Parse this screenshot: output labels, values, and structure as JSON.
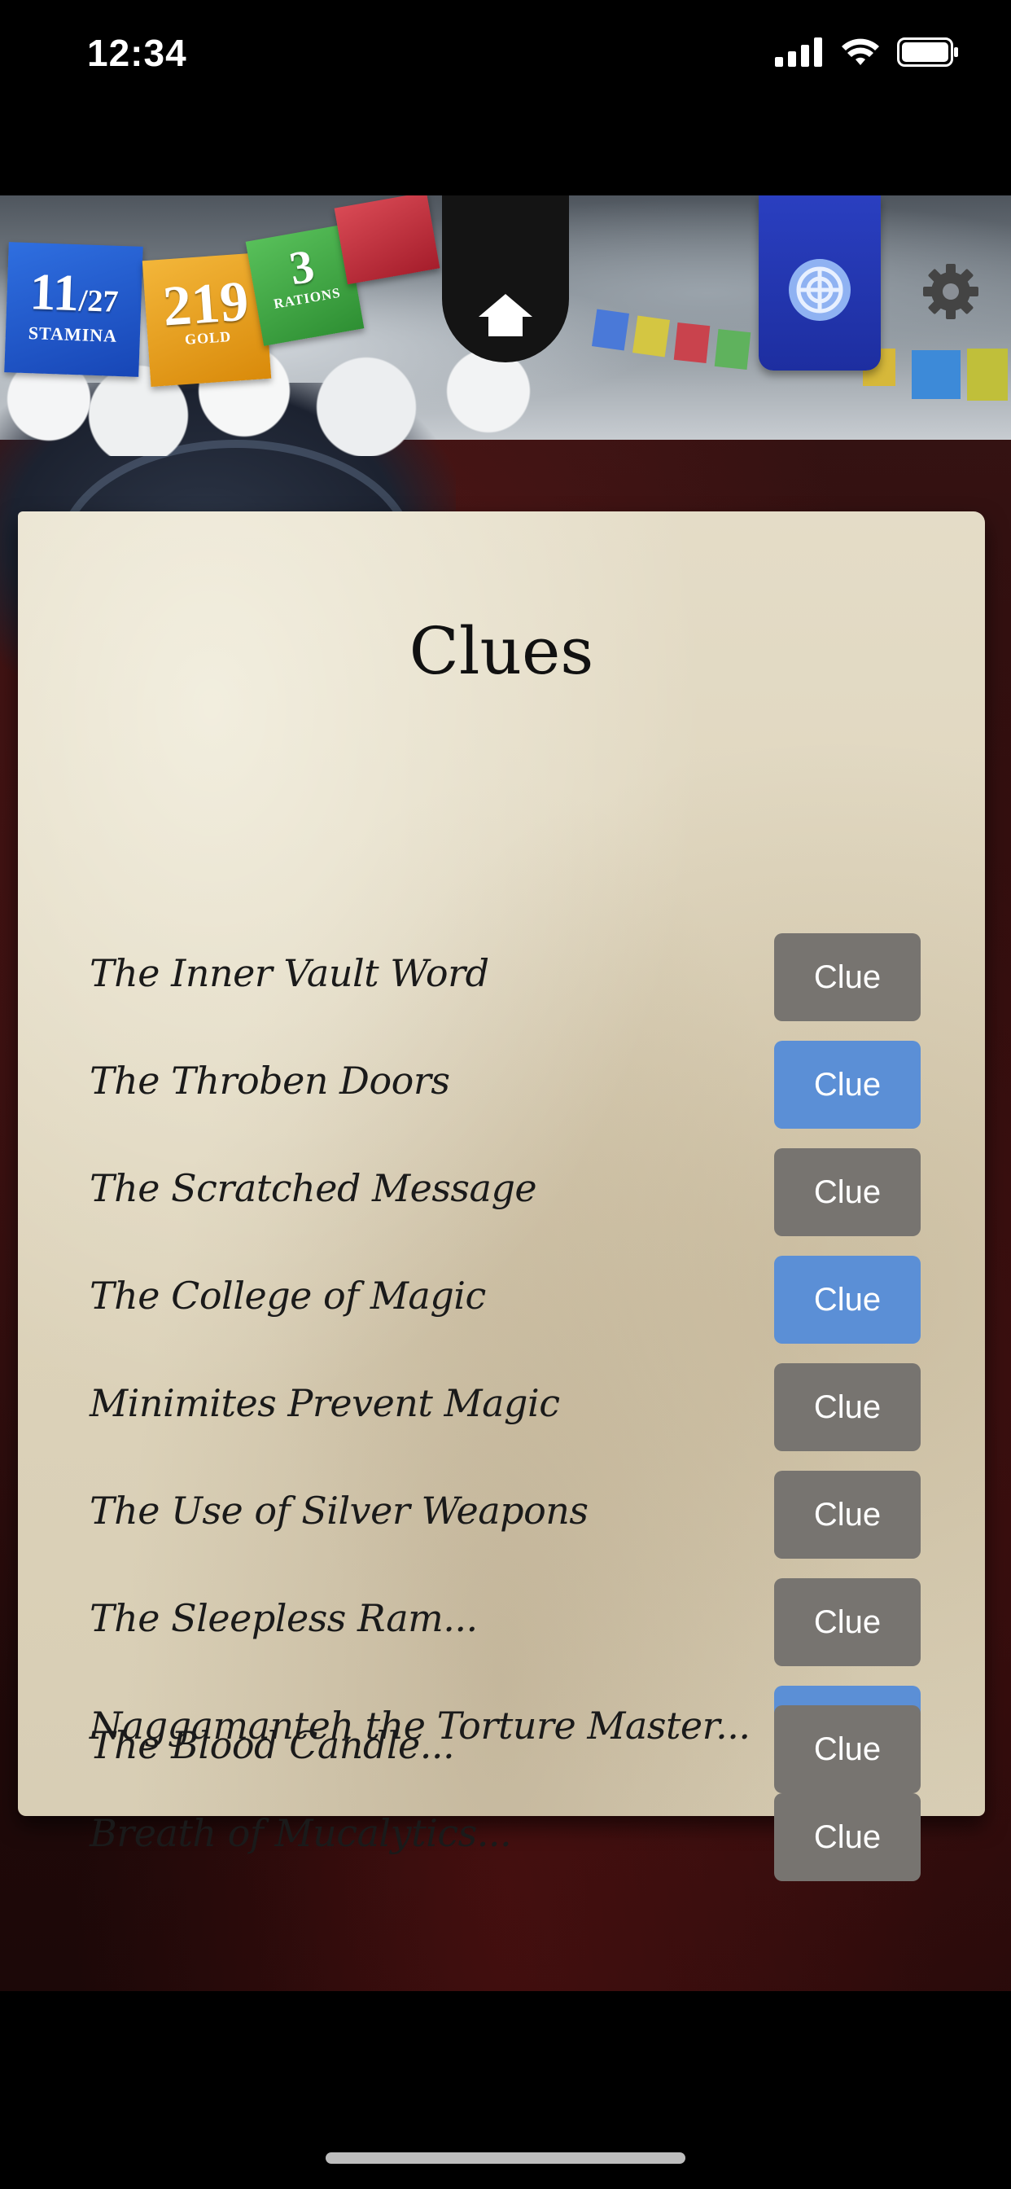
{
  "status_bar": {
    "time": "12:34"
  },
  "hud": {
    "stamina": {
      "current": "11",
      "max": "/27",
      "label": "STAMINA",
      "color": "#2f6fe0"
    },
    "gold": {
      "value": "219",
      "label": "GOLD",
      "color": "#f3b63a"
    },
    "rations": {
      "value": "3",
      "label": "RATIONS",
      "color": "#58c05a"
    },
    "home_icon": "home-icon",
    "settings_icon": "gear-icon"
  },
  "clues_page": {
    "title": "Clues",
    "items": [
      {
        "label": "The Inner Vault Word",
        "button": "Clue",
        "style": "grey"
      },
      {
        "label": "The Throben Doors",
        "button": "Clue",
        "style": "blue"
      },
      {
        "label": "The Scratched Message",
        "button": "Clue",
        "style": "grey"
      },
      {
        "label": "The College of Magic",
        "button": "Clue",
        "style": "blue"
      },
      {
        "label": "Minimites Prevent Magic",
        "button": "Clue",
        "style": "grey"
      },
      {
        "label": "The Use of Silver Weapons",
        "button": "Clue",
        "style": "grey"
      },
      {
        "label": "The Sleepless Ram...",
        "button": "Clue",
        "style": "grey"
      },
      {
        "label": "Naggamanteh the Torture Master...",
        "button": "Clue",
        "style": "blue"
      },
      {
        "label": "Breath of Mucalytics...",
        "button": "Clue",
        "style": "grey"
      },
      {
        "label": "The Blood Candle...",
        "button": "Clue",
        "style": "grey"
      }
    ]
  },
  "colors": {
    "button_grey": "#777470",
    "button_blue": "#5b8fd6",
    "parchment": "#e0d7c0"
  }
}
